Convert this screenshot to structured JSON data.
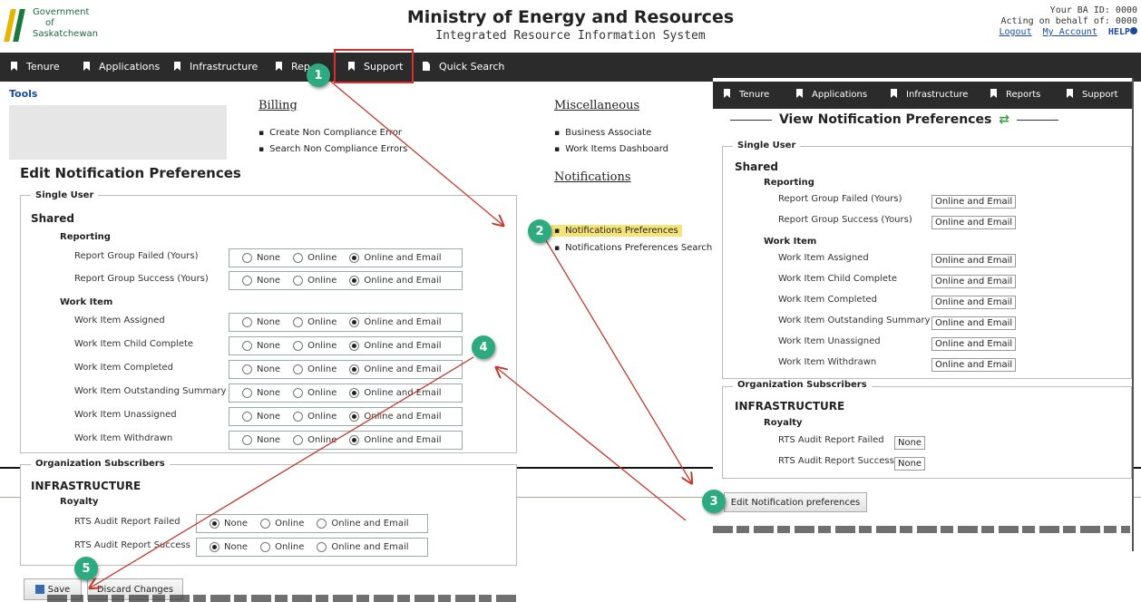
{
  "header": {
    "logo_lines": [
      "Government",
      "of",
      "Saskatchewan"
    ],
    "title": "Ministry of Energy and Resources",
    "subtitle": "Integrated Resource Information System",
    "ba_id": "Your BA ID: 0000",
    "acting": "Acting on behalf of: 0000",
    "logout": "Logout",
    "my_account": "My Account",
    "help": "HELP"
  },
  "nav": [
    "Tenure",
    "Applications",
    "Infrastructure",
    "Rep",
    "Support",
    "Quick Search"
  ],
  "menu": {
    "tools": "Tools",
    "billing_title": "Billing",
    "billing_items": [
      "Create Non Compliance Error",
      "Search Non Compliance Errors"
    ],
    "misc_title": "Miscellaneous",
    "misc_items": [
      "Business Associate",
      "Work Items Dashboard"
    ],
    "notif_title": "Notifications",
    "notif_items": [
      "Notifications Preferences",
      "Notifications Preferences Search"
    ]
  },
  "edit": {
    "title": "Edit Notification Preferences",
    "single_user": "Single User",
    "shared": "Shared",
    "reporting": "Reporting",
    "work_item": "Work Item",
    "options": [
      "None",
      "Online",
      "Online and Email"
    ],
    "rows": [
      {
        "label": "Report Group Failed (Yours)",
        "selected": 2
      },
      {
        "label": "Report Group Success (Yours)",
        "selected": 2
      },
      {
        "label": "Work Item Assigned",
        "selected": 2
      },
      {
        "label": "Work Item Child Complete",
        "selected": 2
      },
      {
        "label": "Work Item Completed",
        "selected": 2
      },
      {
        "label": "Work Item Outstanding Summary",
        "selected": 2
      },
      {
        "label": "Work Item Unassigned",
        "selected": 2
      },
      {
        "label": "Work Item Withdrawn",
        "selected": 2
      }
    ],
    "org_subscribers": "Organization Subscribers",
    "infrastructure": "INFRASTRUCTURE",
    "royalty": "Royalty",
    "org_rows": [
      {
        "label": "RTS Audit Report Failed",
        "selected": 0
      },
      {
        "label": "RTS Audit Report Success",
        "selected": 0
      }
    ],
    "save": "Save",
    "discard": "Discard Changes"
  },
  "view": {
    "nav": [
      "Tenure",
      "Applications",
      "Infrastructure",
      "Reports",
      "Support"
    ],
    "title": "View Notification Preferences",
    "single_user": "Single User",
    "shared": "Shared",
    "reporting": "Reporting",
    "work_item": "Work Item",
    "rows": [
      {
        "label": "Report Group Failed (Yours)",
        "value": "Online and Email"
      },
      {
        "label": "Report Group Success (Yours)",
        "value": "Online and Email"
      },
      {
        "label": "Work Item Assigned",
        "value": "Online and Email"
      },
      {
        "label": "Work Item Child Complete",
        "value": "Online and Email"
      },
      {
        "label": "Work Item Completed",
        "value": "Online and Email"
      },
      {
        "label": "Work Item Outstanding Summary",
        "value": "Online and Email"
      },
      {
        "label": "Work Item Unassigned",
        "value": "Online and Email"
      },
      {
        "label": "Work Item Withdrawn",
        "value": "Online and Email"
      }
    ],
    "org_subscribers": "Organization Subscribers",
    "infrastructure": "INFRASTRUCTURE",
    "royalty": "Royalty",
    "org_rows": [
      {
        "label": "RTS Audit Report Failed",
        "value": "None"
      },
      {
        "label": "RTS Audit Report Success",
        "value": "None"
      }
    ],
    "edit_button": "Edit Notification preferences"
  },
  "callouts": [
    "1",
    "2",
    "3",
    "4",
    "5"
  ],
  "colors": {
    "nav_bg": "#2b2b2b",
    "callout": "#2eaa80",
    "arrow": "#c0392b",
    "highlight": "#f4e47a"
  }
}
